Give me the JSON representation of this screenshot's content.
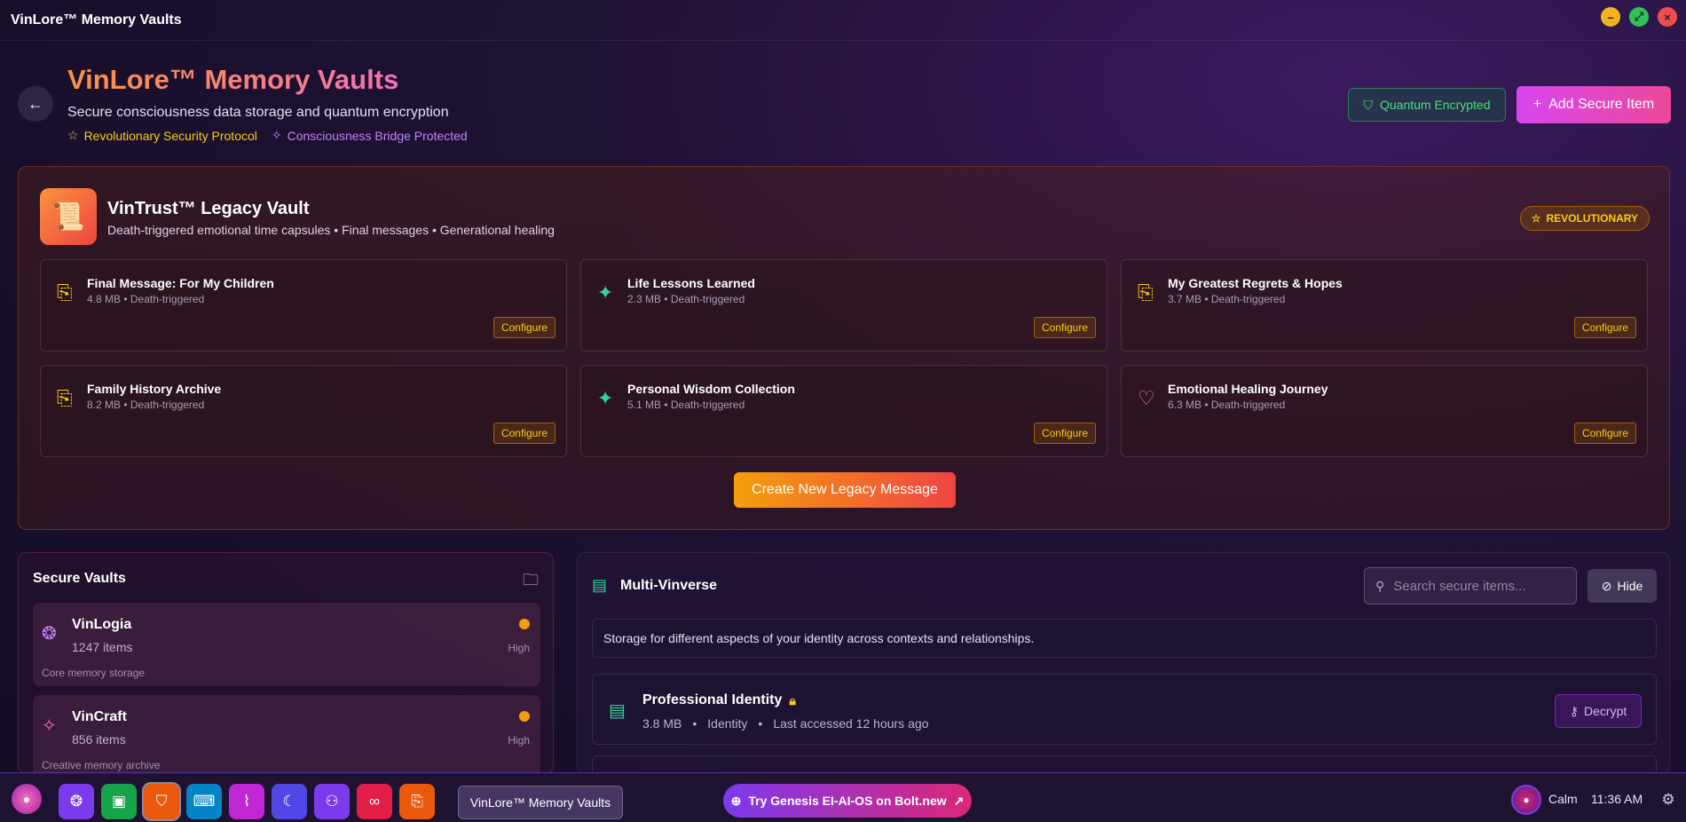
{
  "window": {
    "title": "VinLore™ Memory Vaults",
    "controls": {
      "minimize": "–",
      "maximize": "⤢",
      "close": "×"
    }
  },
  "header": {
    "title": "VinLore™ Memory Vaults",
    "subtitle": "Secure consciousness data storage and quantum encryption",
    "tags": [
      "Revolutionary Security Protocol",
      "Consciousness Bridge Protected"
    ],
    "encrypted_label": "Quantum Encrypted",
    "add_label": "Add Secure Item"
  },
  "legacy": {
    "title": "VinTrust™ Legacy Vault",
    "subtitle": "Death-triggered emotional time capsules • Final messages • Generational healing",
    "badge": "REVOLUTIONARY",
    "configure_label": "Configure",
    "items": [
      {
        "name": "Final Message: For My Children",
        "meta": "4.8 MB • Death-triggered",
        "icon": "scroll-icon"
      },
      {
        "name": "Life Lessons Learned",
        "meta": "2.3 MB • Death-triggered",
        "icon": "sparkles-icon"
      },
      {
        "name": "My Greatest Regrets & Hopes",
        "meta": "3.7 MB • Death-triggered",
        "icon": "scroll-icon"
      },
      {
        "name": "Family History Archive",
        "meta": "8.2 MB • Death-triggered",
        "icon": "scroll-icon"
      },
      {
        "name": "Personal Wisdom Collection",
        "meta": "5.1 MB • Death-triggered",
        "icon": "sparkles-icon"
      },
      {
        "name": "Emotional Healing Journey",
        "meta": "6.3 MB • Death-triggered",
        "icon": "heart-icon"
      }
    ],
    "create_label": "Create New Legacy Message"
  },
  "vaults": {
    "title": "Secure Vaults",
    "items": [
      {
        "name": "VinLogia",
        "count": "1247 items",
        "desc": "Core memory storage",
        "level": "High",
        "status_color": "#f59e0b",
        "icon": "brain-icon"
      },
      {
        "name": "VinCraft",
        "count": "856 items",
        "desc": "Creative memory archive",
        "level": "High",
        "status_color": "#f59e0b",
        "icon": "sparkles-icon"
      }
    ]
  },
  "multiverse": {
    "title": "Multi-Vinverse",
    "search_placeholder": "Search secure items...",
    "hide_label": "Hide",
    "description": "Storage for different aspects of your identity across contexts and relationships.",
    "items": [
      {
        "name": "Professional Identity",
        "size": "3.8 MB",
        "type": "Identity",
        "accessed": "Last accessed 12 hours ago",
        "action": "Decrypt"
      }
    ]
  },
  "taskbar": {
    "apps": [
      {
        "icon": "brain-icon",
        "color": "#7c3aed"
      },
      {
        "icon": "chip-icon",
        "color": "#16a34a"
      },
      {
        "icon": "shield-icon",
        "color": "#ea580c"
      },
      {
        "icon": "keyboard-icon",
        "color": "#0284c7"
      },
      {
        "icon": "activity-icon",
        "color": "#c026d3"
      },
      {
        "icon": "moon-icon",
        "color": "#4f46e5"
      },
      {
        "icon": "users-icon",
        "color": "#7c3aed"
      },
      {
        "icon": "link-icon",
        "color": "#e11d48"
      },
      {
        "icon": "scroll-icon",
        "color": "#ea580c"
      }
    ],
    "active_window": "VinLore™ Memory Vaults",
    "promo": "Try Genesis EI-AI-OS on Bolt.new",
    "mood": "Calm",
    "time": "11:36 AM"
  },
  "colors": {
    "accent_pink": "#ec4899",
    "accent_orange": "#f59e0b",
    "encrypted_green": "#4ade80",
    "badge_gold": "#facc15"
  }
}
